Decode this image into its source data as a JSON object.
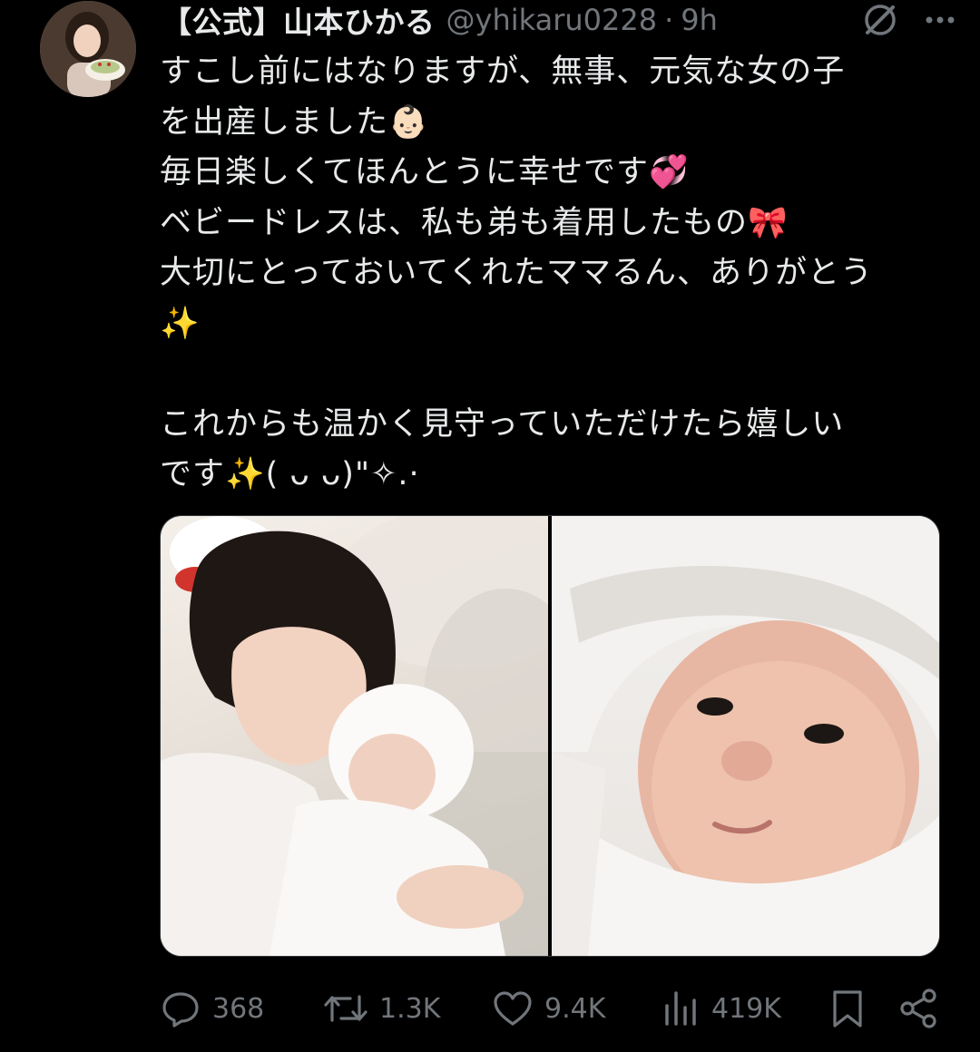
{
  "author": {
    "display_name": "【公式】山本ひかる",
    "handle": "@yhikaru0228",
    "separator": "·",
    "time": "9h",
    "avatar_icon": "profile-photo"
  },
  "tweet": {
    "lines": [
      "すこし前にはなりますが、無事、元気な女の子",
      "を出産しました👶🏻",
      "毎日楽しくてほんとうに幸せです💞",
      "ベビードレスは、私も弟も着用したもの🎀",
      "大切にとっておいてくれたママるん、ありがとう",
      "✨",
      "",
      "これからも温かく見守っていただけたら嬉しい",
      "です✨( ᴗ ᴗ)\"✧.·"
    ]
  },
  "media": {
    "count": 2
  },
  "actions": {
    "replies": "368",
    "reposts": "1.3K",
    "likes": "9.4K",
    "views": "419K"
  },
  "colors": {
    "background": "#000000",
    "text": "#e7e9ea",
    "muted": "#71767b",
    "border": "#2f3336"
  }
}
